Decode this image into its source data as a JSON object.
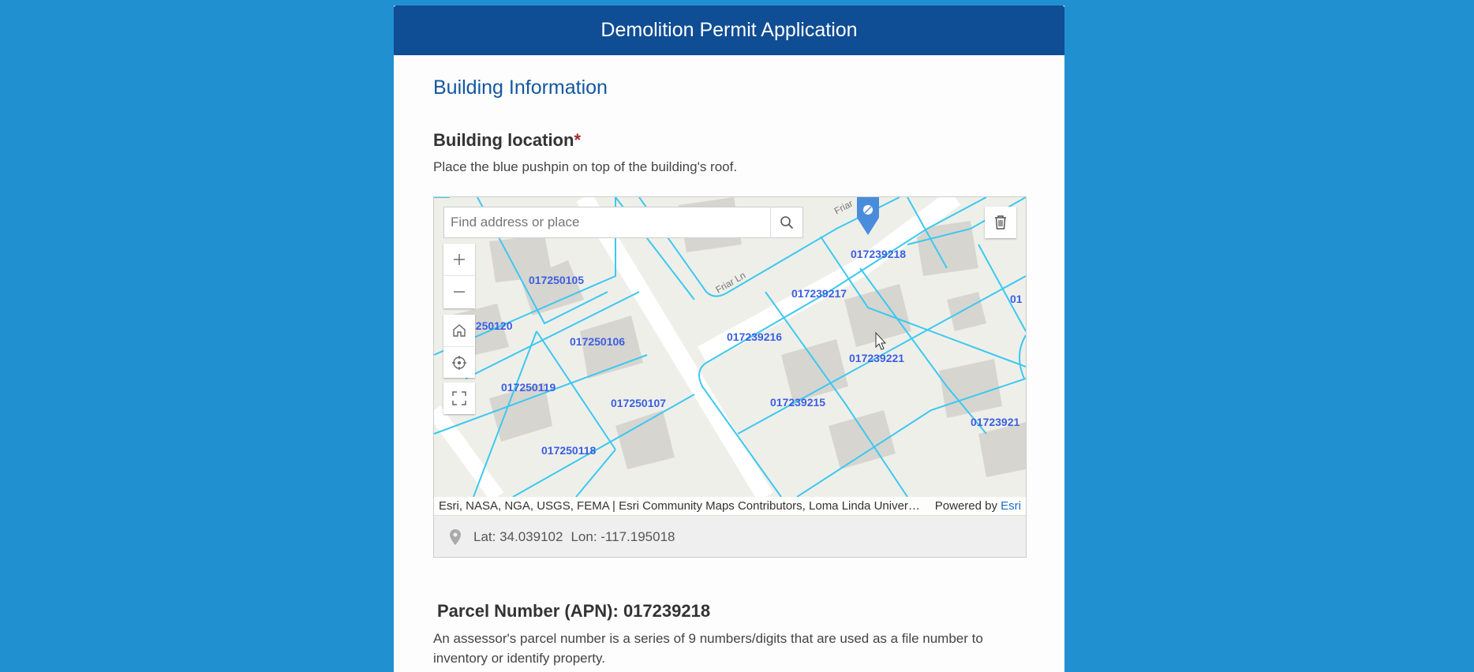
{
  "header": {
    "title": "Demolition Permit Application"
  },
  "section": {
    "title": "Building Information"
  },
  "building_location": {
    "label": "Building location",
    "required_mark": "*",
    "hint": "Place the blue pushpin on top of the building's roof."
  },
  "map": {
    "search_placeholder": "Find address or place",
    "street_label": "Friar Ln",
    "street_label_top": "Friar",
    "parcels": [
      "017250105",
      "7250120",
      "017250106",
      "017250119",
      "017250107",
      "017250118",
      "017239218",
      "017239217",
      "017239216",
      "017239221",
      "017239215",
      "01723921",
      "01"
    ],
    "attribution": "Esri, NASA, NGA, USGS, FEMA | Esri Community Maps Contributors, Loma Linda Univers…",
    "powered_by": "Powered by",
    "esri_link": "Esri",
    "coords": {
      "lat": "Lat: 34.039102",
      "lon": "Lon: -117.195018"
    },
    "colors": {
      "parcel_line": "#3cc8f0",
      "parcel_label": "#3a5fe0",
      "pin": "#4a8cdc"
    }
  },
  "apn": {
    "title": "Parcel Number (APN): 017239218",
    "description": "An assessor's parcel number is a series of 9 numbers/digits that are used as a file number to inventory or identify property."
  },
  "theme": {
    "page_bg": "#2090d0",
    "header_bg": "#0f4d94",
    "section_title": "#1357a0"
  }
}
